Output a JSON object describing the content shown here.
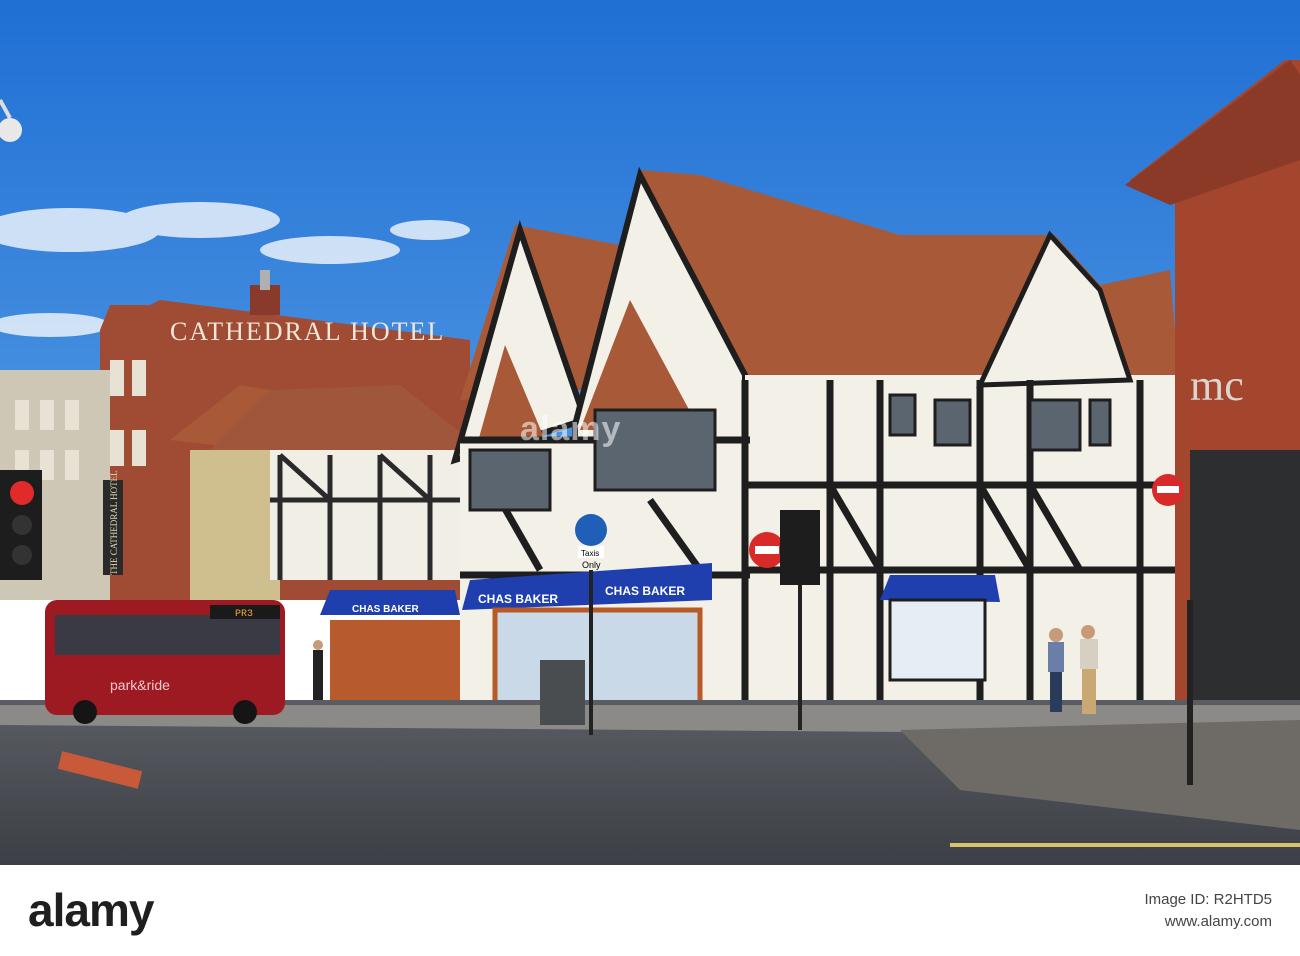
{
  "scene": {
    "hotel_sign": "CATHEDRAL HOTEL",
    "hotel_vertical_sign": "THE CATHEDRAL HOTEL",
    "shop_awning_left": "CHAS BAKER",
    "shop_awning_right": "CHAS BAKER",
    "bus_route": "PR3",
    "bus_livery": "park&ride",
    "sign_only": "Only",
    "sign_taxis": "Taxis",
    "building_letters_right": "mc"
  },
  "watermark": {
    "text": "alamy"
  },
  "footer": {
    "logo": "alamy",
    "image_id_line1": "Image ID: R2HTD5",
    "image_id_line2": "www.alamy.com"
  },
  "colors": {
    "sky": "#2f7fd6",
    "roof": "#a85a38",
    "awning": "#1f3fae",
    "bus": "#9e1a22",
    "brick": "#a04b33"
  }
}
